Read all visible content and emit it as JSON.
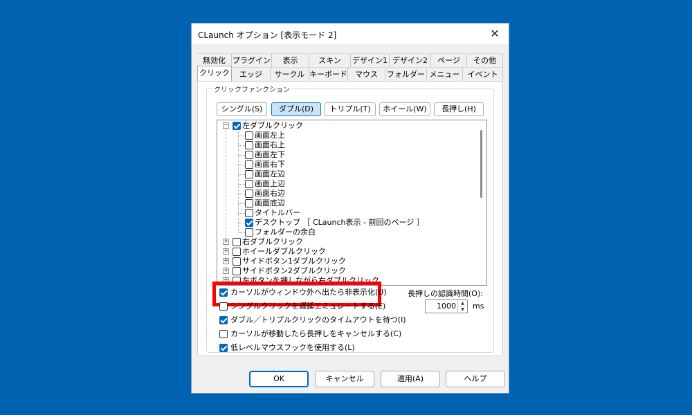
{
  "window": {
    "title": "CLaunch オプション [表示モード 2]",
    "close_glyph": "✕"
  },
  "tabs_row1": [
    "無効化",
    "プラグイン",
    "表示",
    "スキン",
    "デザイン1",
    "デザイン2",
    "ページ",
    "その他"
  ],
  "tabs_row2": [
    "クリック",
    "エッジ",
    "サークル",
    "キーボード",
    "マウス",
    "フォルダー",
    "メニュー",
    "イベント"
  ],
  "active_tab": "クリック",
  "group": {
    "label": "クリックファンクション"
  },
  "segments": [
    "シングル(S)",
    "ダブル(D)",
    "トリプル(T)",
    "ホイール(W)",
    "長押し(H)"
  ],
  "active_segment": "ダブル(D)",
  "tree": {
    "root": {
      "label": "左ダブルクリック",
      "checked": true,
      "expanded": true
    },
    "children": [
      {
        "label": "画面左上",
        "checked": false
      },
      {
        "label": "画面右上",
        "checked": false
      },
      {
        "label": "画面左下",
        "checked": false
      },
      {
        "label": "画面右下",
        "checked": false
      },
      {
        "label": "画面左辺",
        "checked": false
      },
      {
        "label": "画面上辺",
        "checked": false
      },
      {
        "label": "画面右辺",
        "checked": false
      },
      {
        "label": "画面底辺",
        "checked": false
      },
      {
        "label": "タイトルバー",
        "checked": false
      },
      {
        "label": "デスクトップ ［ CLaunch表示 - 前回のページ ］",
        "checked": true
      },
      {
        "label": "フォルダーの余白",
        "checked": false
      }
    ],
    "siblings": [
      {
        "label": "右ダブルクリック",
        "checked": false
      },
      {
        "label": "ホイールダブルクリック",
        "checked": false
      },
      {
        "label": "サイドボタン1ダブルクリック",
        "checked": false
      },
      {
        "label": "サイドボタン2ダブルクリック",
        "checked": false
      },
      {
        "label": "左ボタンを押しながら右ダブルクリック",
        "checked": false
      }
    ]
  },
  "options": [
    {
      "label": "カーソルがウィンドウ外へ出たら非表示化(U)",
      "checked": true
    },
    {
      "label": "シングルクリックを遅延エミュレートする(E)",
      "checked": false
    },
    {
      "label": "ダブル／トリプルクリックのタイムアウトを待つ(I)",
      "checked": true
    },
    {
      "label": "カーソルが移動したら長押しをキャンセルする(C)",
      "checked": false
    },
    {
      "label": "低レベルマウスフックを使用する(L)",
      "checked": true
    }
  ],
  "hold_time": {
    "label": "長押しの認識時間(O):",
    "value": "1000",
    "unit": "ms",
    "up_glyph": "▲",
    "down_glyph": "▼"
  },
  "buttons": {
    "ok": "OK",
    "cancel": "キャンセル",
    "apply": "適用(A)",
    "help": "ヘルプ"
  },
  "colors": {
    "desktop": "#0063b1",
    "accent": "#0067c0",
    "highlight": "#ff0000"
  }
}
